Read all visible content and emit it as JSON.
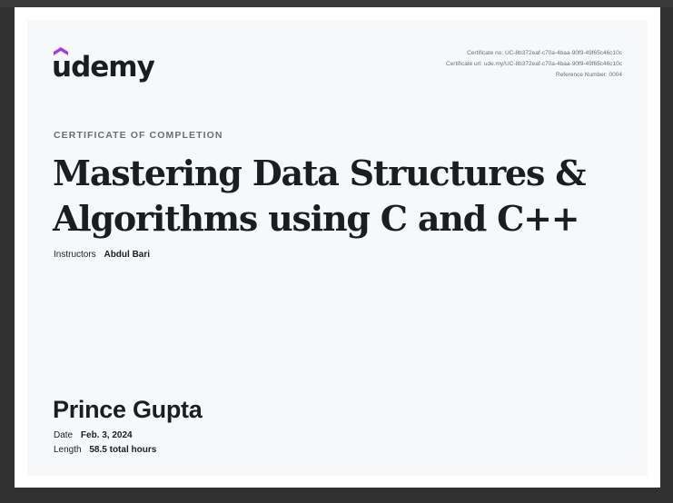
{
  "brand": {
    "name": "udemy",
    "logo_color": "#a435f0"
  },
  "meta": {
    "certificate_no": "Certificate no: UC-8b372eaf-c70a-4baa-90f9-49f65c46c10c",
    "certificate_url": "Certificate url: ude.my/UC-8b372eaf-c70a-4baa-90f9-49f65c46c10c",
    "reference_number": "Reference Number: 0004"
  },
  "certificate": {
    "eyebrow": "CERTIFICATE OF COMPLETION",
    "course_title": "Mastering Data Structures & Algorithms using C and C++",
    "instructors_label": "Instructors",
    "instructors_value": "Abdul Bari",
    "recipient": "Prince Gupta",
    "date_label": "Date",
    "date_value": "Feb. 3, 2024",
    "length_label": "Length",
    "length_value": "58.5 total hours"
  },
  "colors": {
    "text": "#1c1d1f",
    "muted": "#6a6f73",
    "certificate_bg": "#f7f8fa",
    "viewer_bg": "#303030"
  }
}
